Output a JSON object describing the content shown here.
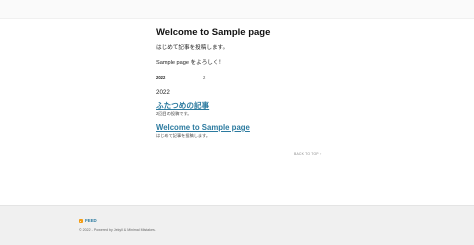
{
  "main": {
    "page_title": "Welcome to Sample page",
    "intro": "はじめて記事を投稿します。",
    "hello": "Sample page をよろしく！",
    "archive_table": {
      "year": "2022",
      "count": "2"
    },
    "year_heading": "2022",
    "posts": [
      {
        "title": "ふたつめの記事",
        "excerpt": "2回目の投稿です。"
      },
      {
        "title": "Welcome to Sample page",
        "excerpt": "はじめて記事を投稿します。"
      }
    ],
    "back_to_top": "BACK TO TOP ↑"
  },
  "footer": {
    "feed_label": "FEED",
    "feed_icon": "rss-icon",
    "copyright": "© 2022 - Powered by Jekyll & Minimal Mistakes."
  }
}
